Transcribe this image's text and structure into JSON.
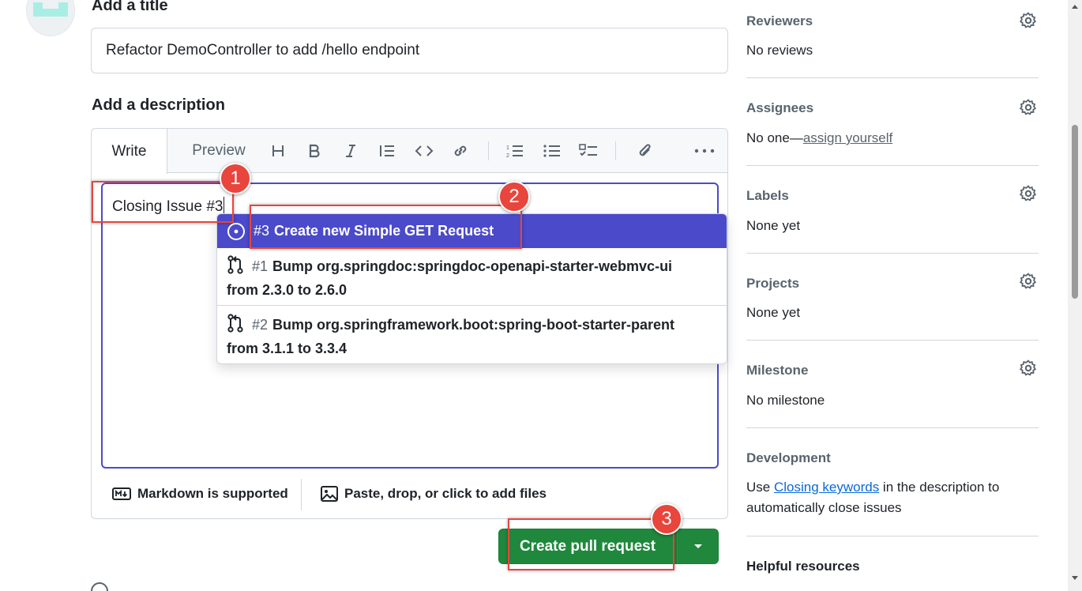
{
  "form": {
    "title_heading": "Add a title",
    "title_value": "Refactor DemoController to add /hello endpoint",
    "description_heading": "Add a description"
  },
  "editor": {
    "tabs": [
      {
        "label": "Write"
      },
      {
        "label": "Preview"
      }
    ],
    "toolbar_icons": [
      "heading-icon",
      "bold-icon",
      "italic-icon",
      "quote-icon",
      "code-icon",
      "link-icon",
      "ordered-list-icon",
      "unordered-list-icon",
      "task-list-icon",
      "attach-icon",
      "more-icon"
    ],
    "typed_text": "Closing Issue #3",
    "markdown_note": "Markdown is supported",
    "files_note": "Paste, drop, or click to add files"
  },
  "suggestions": [
    {
      "number": "#3",
      "title": "Create new Simple GET Request",
      "icon": "issue-open-icon",
      "active": true
    },
    {
      "number": "#1",
      "title": "Bump org.springdoc:springdoc-openapi-starter-webmvc-ui",
      "subtitle": "from 2.3.0 to 2.6.0",
      "icon": "pull-request-icon"
    },
    {
      "number": "#2",
      "title": "Bump org.springframework.boot:spring-boot-starter-parent",
      "subtitle": "from 3.1.1 to 3.3.4",
      "icon": "pull-request-icon"
    }
  ],
  "actions": {
    "create_label": "Create pull request"
  },
  "annotations": [
    {
      "label": "1"
    },
    {
      "label": "2"
    },
    {
      "label": "3"
    }
  ],
  "sidebar": {
    "reviewers": {
      "heading": "Reviewers",
      "value": "No reviews"
    },
    "assignees": {
      "heading": "Assignees",
      "value_prefix": "No one—",
      "value_link": "assign yourself"
    },
    "labels": {
      "heading": "Labels",
      "value": "None yet"
    },
    "projects": {
      "heading": "Projects",
      "value": "None yet"
    },
    "milestone": {
      "heading": "Milestone",
      "value": "No milestone"
    },
    "development": {
      "heading": "Development",
      "text_before": "Use ",
      "link": "Closing keywords",
      "text_after": " in the description to automatically close issues"
    },
    "helpful": {
      "heading": "Helpful resources"
    }
  },
  "colors": {
    "accent": "#4b4acb",
    "green": "#1f883d",
    "annotation": "#e8453c"
  }
}
